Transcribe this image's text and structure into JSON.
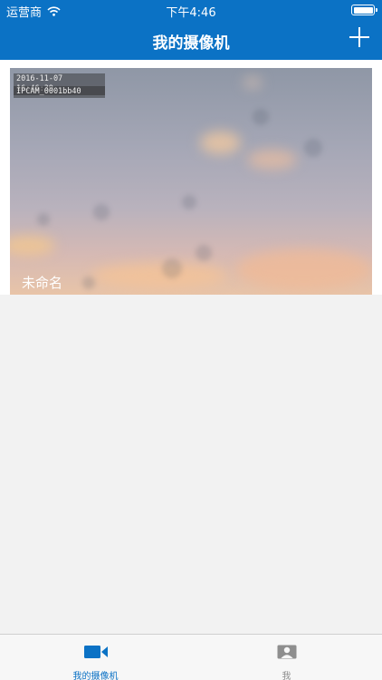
{
  "status_bar": {
    "carrier": "运营商",
    "time": "下午4:46"
  },
  "nav": {
    "title": "我的摄像机",
    "add_icon": "plus-icon"
  },
  "camera": {
    "name": "未命名",
    "osd_timestamp": "2016-11-07 16:46:39",
    "osd_camera_id": "IPCAM_0001bb40"
  },
  "tabs": [
    {
      "label": "我的摄像机",
      "icon": "video-camera-icon",
      "active": true
    },
    {
      "label": "我",
      "icon": "person-icon",
      "active": false
    }
  ],
  "colors": {
    "brand": "#0b72c5",
    "background": "#f2f2f2",
    "inactive_tab": "#8e8e8e"
  }
}
